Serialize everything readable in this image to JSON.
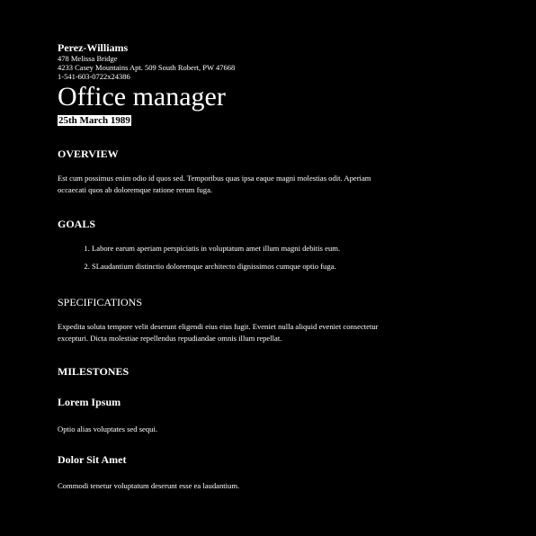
{
  "header": {
    "company": "Perez-Williams",
    "address_line1": "478 Melissa Bridge",
    "address_line2": "4233 Casey Mountains Apt. 509 South Robert, PW 47668",
    "phone": "1-541-603-0722x24386",
    "title": "Office manager",
    "date": "25th March 1989"
  },
  "overview": {
    "heading": "OVERVIEW",
    "text": "Est cum possimus enim odio id quos sed. Temporibus quas ipsa eaque magni molestias odit. Aperiam occaecati quos ab doloremque ratione rerum fuga."
  },
  "goals": {
    "heading": "GOALS",
    "items": [
      "Labore earum aperiam perspiciatis in voluptatum amet illum magni debitis eum.",
      "SLaudantium distinctio doloremque architecto dignissimos cumque optio fuga."
    ]
  },
  "specifications": {
    "heading": "SPECIFICATIONS",
    "text": "Expedita soluta tempore velit deserunt eligendi eius eius fugit. Eveniet nulla aliquid eveniet consectetur excepturi. Dicta molestiae repellendus repudiandae omnis illum repellat."
  },
  "milestones": {
    "heading": "MILESTONES",
    "items": [
      {
        "title": "Lorem Ipsum",
        "text": "Optio alias voluptates sed sequi."
      },
      {
        "title": "Dolor Sit Amet",
        "text": "Commodi tenetur voluptatum deserunt esse ea laudantium."
      }
    ]
  },
  "colors": {
    "background": "#000000",
    "text": "#ffffff",
    "date_highlight_bg": "#ffffff",
    "date_highlight_fg": "#000000"
  }
}
